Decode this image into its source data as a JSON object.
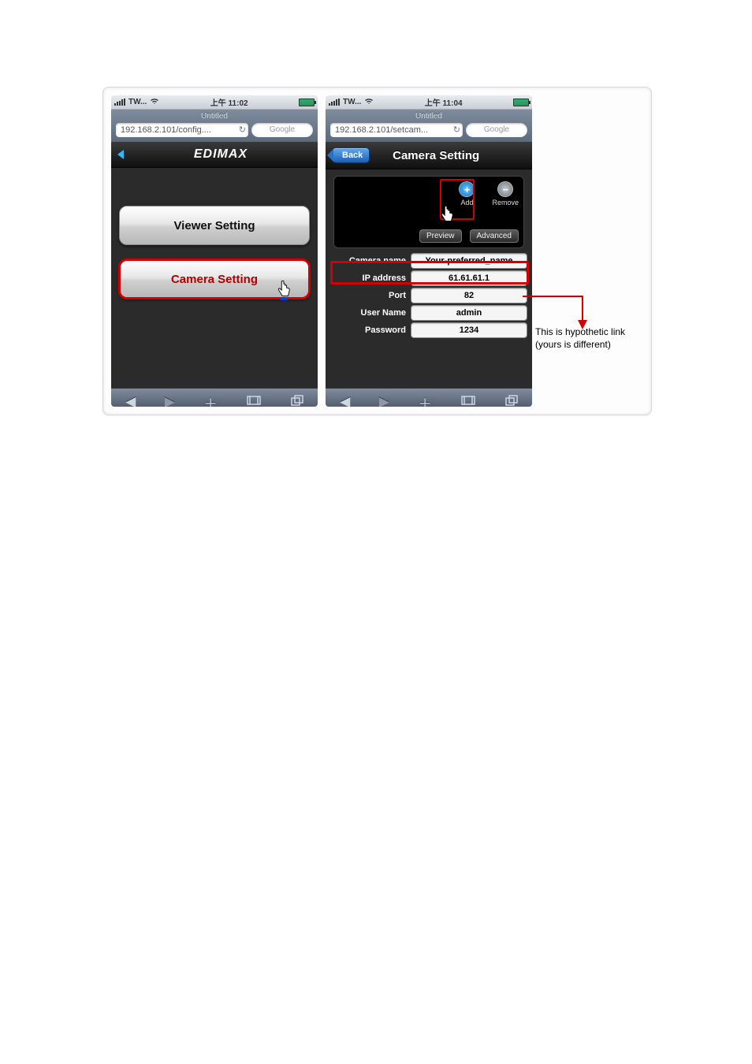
{
  "status": {
    "carrier": "TW...",
    "time_left": "上午 11:02",
    "time_right": "上午 11:04"
  },
  "url_left": "192.168.2.101/config....",
  "url_right": "192.168.2.101/setcam...",
  "tab_title": "Untitled",
  "search_placeholder": "Google",
  "brand": "EDIMAX",
  "viewer_btn": "Viewer Setting",
  "camera_btn": "Camera Setting",
  "back_label": "Back",
  "page_title_right": "Camera Setting",
  "preview": {
    "add": "Add",
    "remove": "Remove",
    "preview": "Preview",
    "advanced": "Advanced"
  },
  "form": {
    "camera_name_label": "Camera name",
    "camera_name_value": "Your-preferred_name",
    "ip_label": "IP address",
    "ip_value": "61.61.61.1",
    "port_label": "Port",
    "port_value": "82",
    "user_label": "User Name",
    "user_value": "admin",
    "pwd_label": "Password",
    "pwd_value": "1234"
  },
  "annotation": {
    "line1": "This is hypothetic link",
    "line2": "(yours is different)"
  }
}
